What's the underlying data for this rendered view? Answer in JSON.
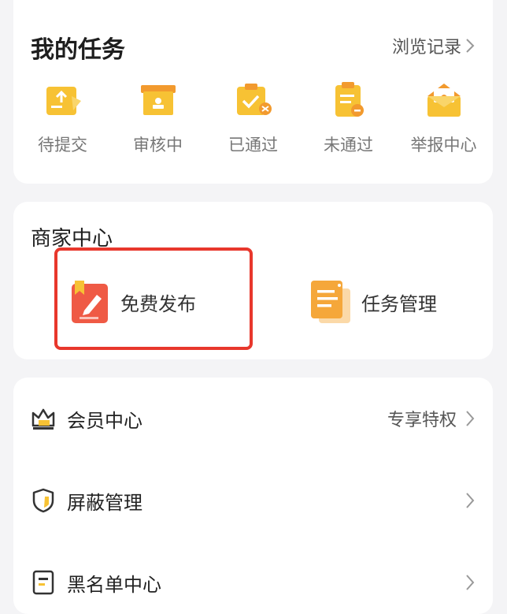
{
  "my_tasks": {
    "title": "我的任务",
    "history_link": "浏览记录",
    "items": [
      {
        "label": "待提交",
        "icon": "upload-doc-icon"
      },
      {
        "label": "审核中",
        "icon": "review-box-icon"
      },
      {
        "label": "已通过",
        "icon": "approved-check-icon"
      },
      {
        "label": "未通过",
        "icon": "rejected-clipboard-icon"
      },
      {
        "label": "举报中心",
        "icon": "report-envelope-icon"
      }
    ]
  },
  "merchant": {
    "title": "商家中心",
    "items": [
      {
        "label": "免费发布",
        "icon": "pencil-book-icon"
      },
      {
        "label": "任务管理",
        "icon": "document-stack-icon"
      }
    ],
    "highlight_color": "#e8372c"
  },
  "menu": {
    "items": [
      {
        "label": "会员中心",
        "right_text": "专享特权",
        "icon": "crown-icon"
      },
      {
        "label": "屏蔽管理",
        "right_text": "",
        "icon": "shield-icon"
      },
      {
        "label": "黑名单中心",
        "right_text": "",
        "icon": "blacklist-doc-icon"
      }
    ]
  },
  "colors": {
    "accent_yellow": "#f7c234",
    "accent_orange": "#f29a2e",
    "publish_red": "#ef5a45"
  }
}
